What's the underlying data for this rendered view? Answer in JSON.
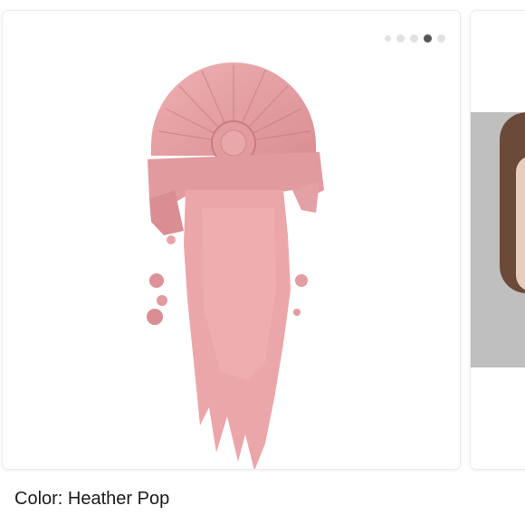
{
  "carousel": {
    "slide_count": 5,
    "active_index": 3,
    "main_image": "blush-powder-swatch",
    "next_image": "model-face-photo"
  },
  "caption": {
    "text": "Color: Heather Pop"
  },
  "colors": {
    "blush": "#e8a3a6",
    "blush_dark": "#d78a8f",
    "dot_active": "#555555",
    "dot_inactive": "#e2e2e2"
  }
}
